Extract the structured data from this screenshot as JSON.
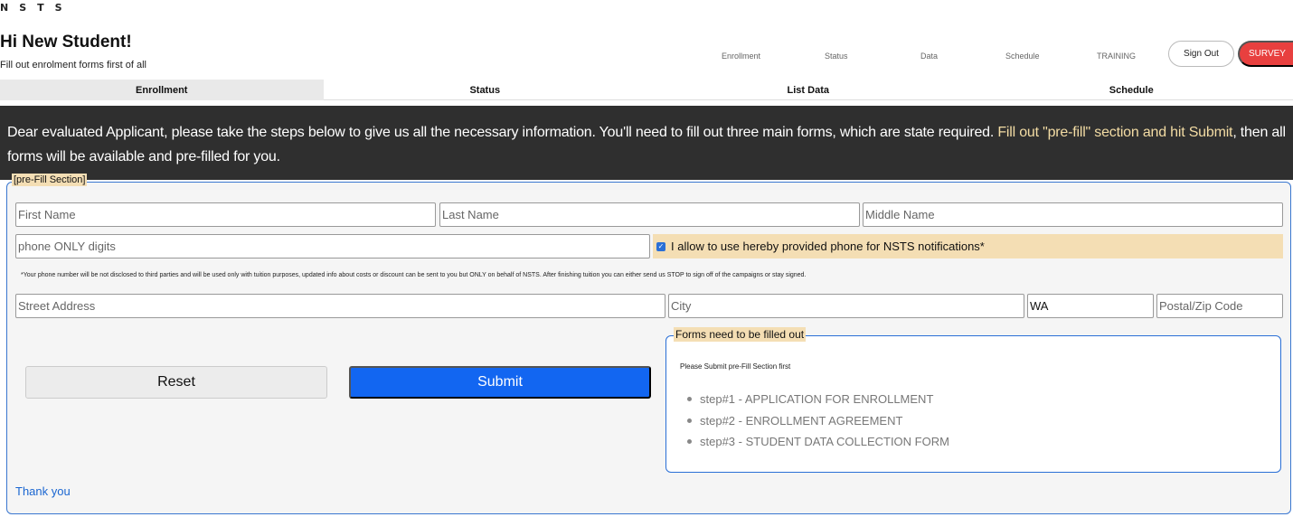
{
  "brand": {
    "logo": "NSTS"
  },
  "header": {
    "greeting": "Hi New Student!",
    "subtitle": "Fill out enrolment forms first of all",
    "nav": [
      "Enrollment",
      "Status",
      "Data",
      "Schedule",
      "TRAINING"
    ],
    "signout_label": "Sign Out",
    "survey_label": "SURVEY",
    "survey_color": "#e8403f"
  },
  "tabs": [
    {
      "label": "Enrollment",
      "active": true
    },
    {
      "label": "Status"
    },
    {
      "label": "List Data"
    },
    {
      "label": "Schedule"
    }
  ],
  "banner": {
    "text_before": "Dear evaluated Applicant, please take the steps below to give us all the necessary information. You'll need to fill out three main forms, which are state required. ",
    "highlight": "Fill out \"pre-fill\" section and hit Submit",
    "text_after": ", then all forms will be available and pre-filled for you.",
    "highlight_color": "#f3dca4"
  },
  "prefill": {
    "legend": "[pre-Fill Section]",
    "first_name_placeholder": "First Name",
    "last_name_placeholder": "Last Name",
    "middle_name_placeholder": "Middle Name",
    "phone_placeholder": "phone ONLY digits",
    "consent_label": "I allow to use hereby provided phone for NSTS notifications*",
    "consent_checked": true,
    "disclaimer": "*Your phone number will be not disclosed to third parties and will be used only with tuition purposes, updated info about costs or discount can be sent to you but ONLY on behalf of NSTS. After finishing tuition you can either send us STOP to sign off of the campaigns or stay signed.",
    "street_placeholder": "Street Address",
    "city_placeholder": "City",
    "state_value": "WA",
    "zip_placeholder": "Postal/Zip Code",
    "reset_label": "Reset",
    "submit_label": "Submit",
    "submit_color": "#1266f1"
  },
  "forms": {
    "legend": "Forms need to be filled out",
    "note": "Please Submit pre-Fill Section first",
    "steps": [
      "step#1 - APPLICATION FOR ENROLLMENT",
      "step#2 - ENROLLMENT AGREEMENT",
      "step#3 - STUDENT DATA COLLECTION FORM"
    ]
  },
  "footer": {
    "thank_you": "Thank you"
  }
}
